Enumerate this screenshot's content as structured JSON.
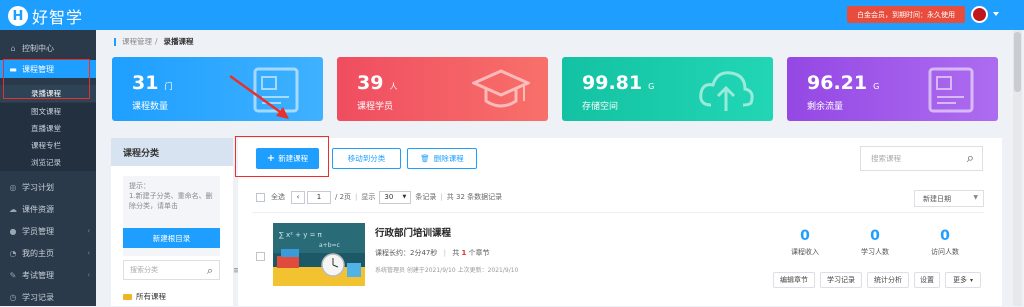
{
  "app": {
    "name": "好智学",
    "logo_letter": "H"
  },
  "topbar": {
    "vip_text": "白金会员，到期时间：永久使用"
  },
  "sidebar": {
    "items": [
      {
        "label": "控制中心",
        "icon": "home-icon"
      },
      {
        "label": "课程管理",
        "icon": "book-icon",
        "active": true
      },
      {
        "label": "学习计划",
        "icon": "compass-icon"
      },
      {
        "label": "课件资源",
        "icon": "cloud-icon"
      },
      {
        "label": "学员管理",
        "icon": "user-icon"
      },
      {
        "label": "我的主页",
        "icon": "rss-icon"
      },
      {
        "label": "考试管理",
        "icon": "edit-icon"
      },
      {
        "label": "学习记录",
        "icon": "clock-icon"
      }
    ],
    "sub_items": [
      "录播课程",
      "图文课程",
      "直播课堂",
      "课程专栏",
      "浏览记录"
    ]
  },
  "breadcrumb": {
    "parent": "课程管理",
    "sep": "/",
    "current": "录播课程"
  },
  "stats": [
    {
      "value": "31",
      "unit": "门",
      "label": "课程数量",
      "color": "#1e9fff"
    },
    {
      "value": "39",
      "unit": "人",
      "label": "课程学员",
      "color": "#f1535f"
    },
    {
      "value": "99.81",
      "unit": "G",
      "label": "存储空间",
      "color": "#15c8a8"
    },
    {
      "value": "96.21",
      "unit": "G",
      "label": "剩余流量",
      "color": "#9a54e6"
    }
  ],
  "left_panel": {
    "title": "课程分类",
    "tip": "提示：\n1.新建子分类、重命名、删除分类，请单击",
    "new_dir_button": "新建根目录",
    "search_placeholder": "搜索分类",
    "all_courses": "所有课程"
  },
  "toolbar": {
    "new_course": "新建课程",
    "move_category": "移动到分类",
    "delete_course": "删除课程",
    "search_placeholder": "搜索课程"
  },
  "pager": {
    "select_all": "全选",
    "page": "1",
    "total_pages": "/ 2页",
    "display": "显示",
    "page_size": "30",
    "per_page": "条记录",
    "total_text": "共 32 条数据记录",
    "sort": "新建日期"
  },
  "course": {
    "title": "行政部门培训课程",
    "duration_label": "课程长约：",
    "duration": "2分47秒",
    "chapters_pre": "共",
    "chapters_count": "1",
    "chapters_post": "个章节",
    "sys_info": "系统管理员 创建于2021/9/10 上次更新：2021/9/10",
    "metrics": [
      {
        "value": "0",
        "label": "课程收入"
      },
      {
        "value": "0",
        "label": "学习人数"
      },
      {
        "value": "0",
        "label": "访问人数"
      }
    ],
    "actions": [
      "编辑章节",
      "学习记录",
      "统计分析",
      "设置",
      "更多"
    ]
  }
}
